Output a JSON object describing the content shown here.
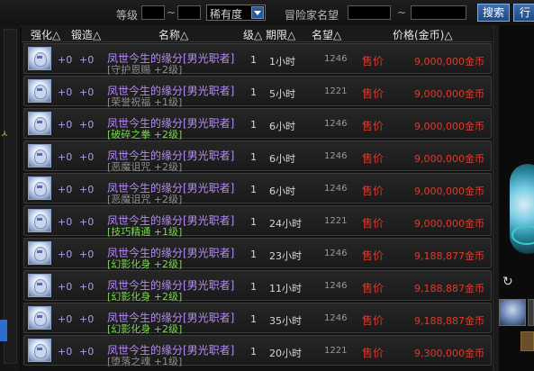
{
  "filters": {
    "level_label": "等级",
    "rarity_selected": "稀有度",
    "reputation_label": "冒险家名望",
    "range_separator": "~",
    "search_label": "搜索",
    "next_label": "行"
  },
  "columns": {
    "enhance": "强化△",
    "forge": "锻造△",
    "name": "名称△",
    "level": "级△",
    "duration": "期限△",
    "reputation": "名望△",
    "price": "价格(金币)△"
  },
  "side_char": "ㅅ",
  "rows": [
    {
      "enhance": "+0",
      "forge": "+0",
      "name": "凤世今生的缘分[男光职者]",
      "sub": "[守护恩赐 +2级]",
      "sub_green": false,
      "level": "1",
      "duration": "1小时",
      "reputation": "1246",
      "status": "售价",
      "price": "9,000,000金币"
    },
    {
      "enhance": "+0",
      "forge": "+0",
      "name": "凤世今生的缘分[男光职者]",
      "sub": "[荣誉祝福 +1级]",
      "sub_green": false,
      "level": "1",
      "duration": "5小时",
      "reputation": "1221",
      "status": "售价",
      "price": "9,000,000金币"
    },
    {
      "enhance": "+0",
      "forge": "+0",
      "name": "凤世今生的缘分[男光职者]",
      "sub": "[破碎之拳 +2级]",
      "sub_green": true,
      "level": "1",
      "duration": "6小时",
      "reputation": "1246",
      "status": "售价",
      "price": "9,000,000金币"
    },
    {
      "enhance": "+0",
      "forge": "+0",
      "name": "凤世今生的缘分[男光职者]",
      "sub": "[恶魔诅咒 +2级]",
      "sub_green": false,
      "level": "1",
      "duration": "6小时",
      "reputation": "1246",
      "status": "售价",
      "price": "9,000,000金币"
    },
    {
      "enhance": "+0",
      "forge": "+0",
      "name": "凤世今生的缘分[男光职者]",
      "sub": "[恶魔诅咒 +2级]",
      "sub_green": false,
      "level": "1",
      "duration": "6小时",
      "reputation": "1246",
      "status": "售价",
      "price": "9,000,000金币"
    },
    {
      "enhance": "+0",
      "forge": "+0",
      "name": "凤世今生的缘分[男光职者]",
      "sub": "[技巧精通 +1级]",
      "sub_green": true,
      "level": "1",
      "duration": "24小时",
      "reputation": "1221",
      "status": "售价",
      "price": "9,000,000金币"
    },
    {
      "enhance": "+0",
      "forge": "+0",
      "name": "凤世今生的缘分[男光职者]",
      "sub": "[幻影化身 +2级]",
      "sub_green": true,
      "level": "1",
      "duration": "23小时",
      "reputation": "1246",
      "status": "售价",
      "price": "9,188,877金币"
    },
    {
      "enhance": "+0",
      "forge": "+0",
      "name": "凤世今生的缘分[男光职者]",
      "sub": "[幻影化身 +2级]",
      "sub_green": true,
      "level": "1",
      "duration": "11小时",
      "reputation": "1246",
      "status": "售价",
      "price": "9,188,887金币"
    },
    {
      "enhance": "+0",
      "forge": "+0",
      "name": "凤世今生的缘分[男光职者]",
      "sub": "[幻影化身 +2级]",
      "sub_green": true,
      "level": "1",
      "duration": "35小时",
      "reputation": "1246",
      "status": "售价",
      "price": "9,188,887金币"
    },
    {
      "enhance": "+0",
      "forge": "+0",
      "name": "凤世今生的缘分[男光职者]",
      "sub": "[堕落之魂 +1级]",
      "sub_green": false,
      "level": "1",
      "duration": "20小时",
      "reputation": "1221",
      "status": "售价",
      "price": "9,300,000金币"
    }
  ]
}
